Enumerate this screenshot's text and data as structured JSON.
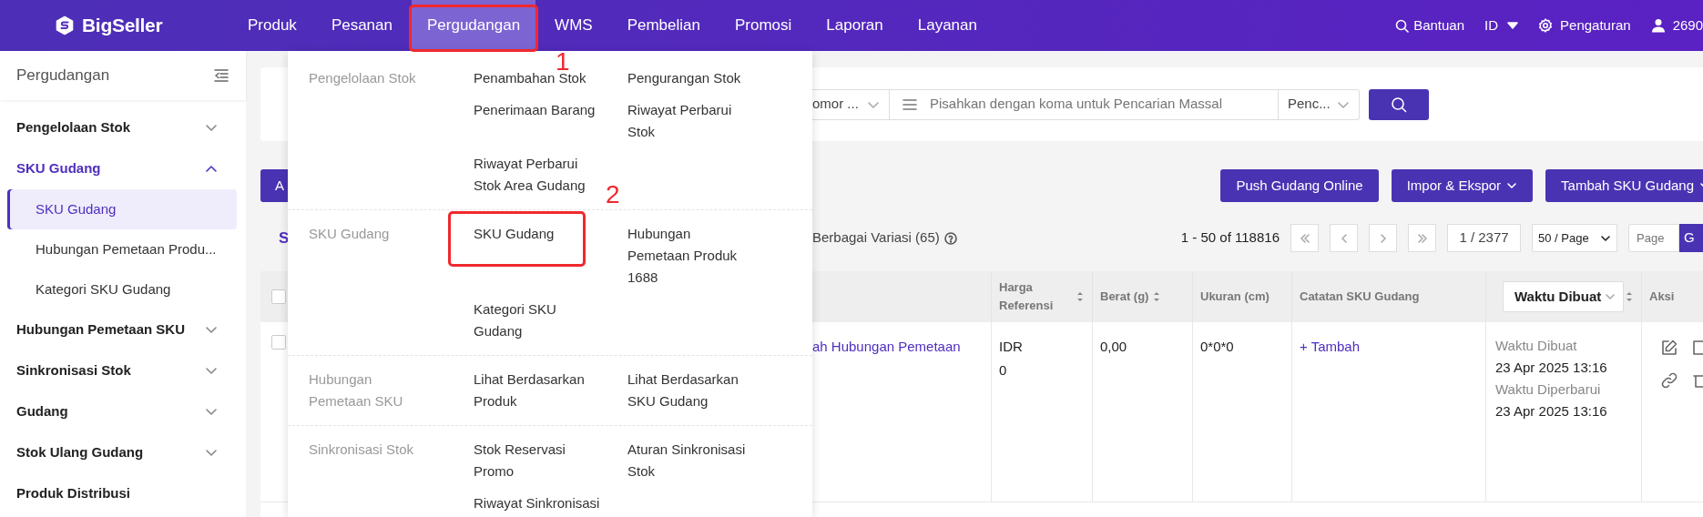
{
  "navbar": {
    "logo": "BigSeller",
    "menu": [
      {
        "label": "Produk",
        "selected": false
      },
      {
        "label": "Pesanan",
        "selected": false
      },
      {
        "label": "Pergudangan",
        "selected": true,
        "annotation": "1"
      },
      {
        "label": "WMS",
        "selected": false
      },
      {
        "label": "Pembelian",
        "selected": false
      },
      {
        "label": "Promosi",
        "selected": false
      },
      {
        "label": "Laporan",
        "selected": false
      },
      {
        "label": "Layanan",
        "selected": false
      }
    ],
    "help": "Bantuan",
    "language": "ID",
    "settings": "Pengaturan",
    "user": "2690"
  },
  "sidebar": {
    "title": "Pergudangan",
    "items": [
      {
        "label": "Pengelolaan Stok",
        "selected": false,
        "expanded": false
      },
      {
        "label": "SKU Gudang",
        "selected": true,
        "expanded": true,
        "children": [
          {
            "label": "SKU Gudang",
            "selected": true
          },
          {
            "label": "Hubungan Pemetaan Produ...",
            "selected": false
          },
          {
            "label": "Kategori SKU Gudang",
            "selected": false
          }
        ]
      },
      {
        "label": "Hubungan Pemetaan SKU",
        "selected": false,
        "expanded": false
      },
      {
        "label": "Sinkronisasi Stok",
        "selected": false,
        "expanded": false
      },
      {
        "label": "Gudang",
        "selected": false,
        "expanded": false
      },
      {
        "label": "Stok Ulang Gudang",
        "selected": false,
        "expanded": false
      },
      {
        "label": "Produk Distribusi",
        "selected": false
      }
    ]
  },
  "dropdown": {
    "sections": [
      {
        "title": "Pengelolaan Stok",
        "items": [
          {
            "label": "Penambahan Stok"
          },
          {
            "label": "Pengurangan Stok"
          },
          {
            "label": "Penerimaan Barang"
          },
          {
            "label": "Riwayat Perbarui Stok"
          },
          {
            "label": "Riwayat Perbarui Stok Area Gudang"
          }
        ]
      },
      {
        "title": "SKU Gudang",
        "items": [
          {
            "label": "SKU Gudang",
            "annotation": "2"
          },
          {
            "label": "Hubungan Pemetaan Produk 1688"
          },
          {
            "label": "Kategori SKU Gudang"
          }
        ]
      },
      {
        "title": "Hubungan Pemetaan SKU",
        "items": [
          {
            "label": "Lihat Berdasarkan Produk"
          },
          {
            "label": "Lihat Berdasarkan SKU Gudang"
          }
        ]
      },
      {
        "title": "Sinkronisasi Stok",
        "items": [
          {
            "label": "Stok Reservasi Promo"
          },
          {
            "label": "Aturan Sinkronisasi Stok"
          },
          {
            "label": "Riwayat Sinkronisasi"
          }
        ]
      }
    ]
  },
  "search": {
    "filter": "omor ...",
    "placeholder": "Pisahkan dengan koma untuk Pencarian Massal",
    "mode": "Penc..."
  },
  "toolbar": {
    "left_button": "A",
    "buttons": [
      {
        "label": "Push Gudang Online",
        "kind": "button"
      },
      {
        "label": "Impor & Ekspor",
        "kind": "dropdown"
      },
      {
        "label": "Tambah SKU Gudang",
        "kind": "dropdown"
      }
    ]
  },
  "tabs": [
    {
      "label": "S",
      "selected": true
    },
    {
      "label": "Berbagai Variasi (65)",
      "selected": false
    }
  ],
  "pagination": {
    "range": "1 - 50 of 118816",
    "page": "1 / 2377",
    "page_size": "50 / Page",
    "jump_placeholder": "Page",
    "go": "G"
  },
  "table": {
    "select_all_checked": false,
    "columns": [
      {
        "label": "Harga Referensi",
        "sortable": true
      },
      {
        "label": "Berat (g)",
        "sortable": true
      },
      {
        "label": "Ukuran (cm)",
        "sortable": false
      },
      {
        "label": "Catatan SKU Gudang",
        "sortable": false
      },
      {
        "label": "Waktu Dibuat",
        "kind": "select",
        "sortable": true
      },
      {
        "label": "Aksi",
        "sortable": false
      }
    ],
    "rows": [
      {
        "checked": false,
        "mapping_link": "ah Hubungan Pemetaan",
        "price_currency": "IDR",
        "price": "0",
        "weight": "0,00",
        "size": "0*0*0",
        "note_action": "+ Tambah",
        "created_label": "Waktu Dibuat",
        "created": "23 Apr 2025 13:16",
        "updated_label": "Waktu Diperbarui",
        "updated": "23 Apr 2025 13:16"
      }
    ]
  }
}
